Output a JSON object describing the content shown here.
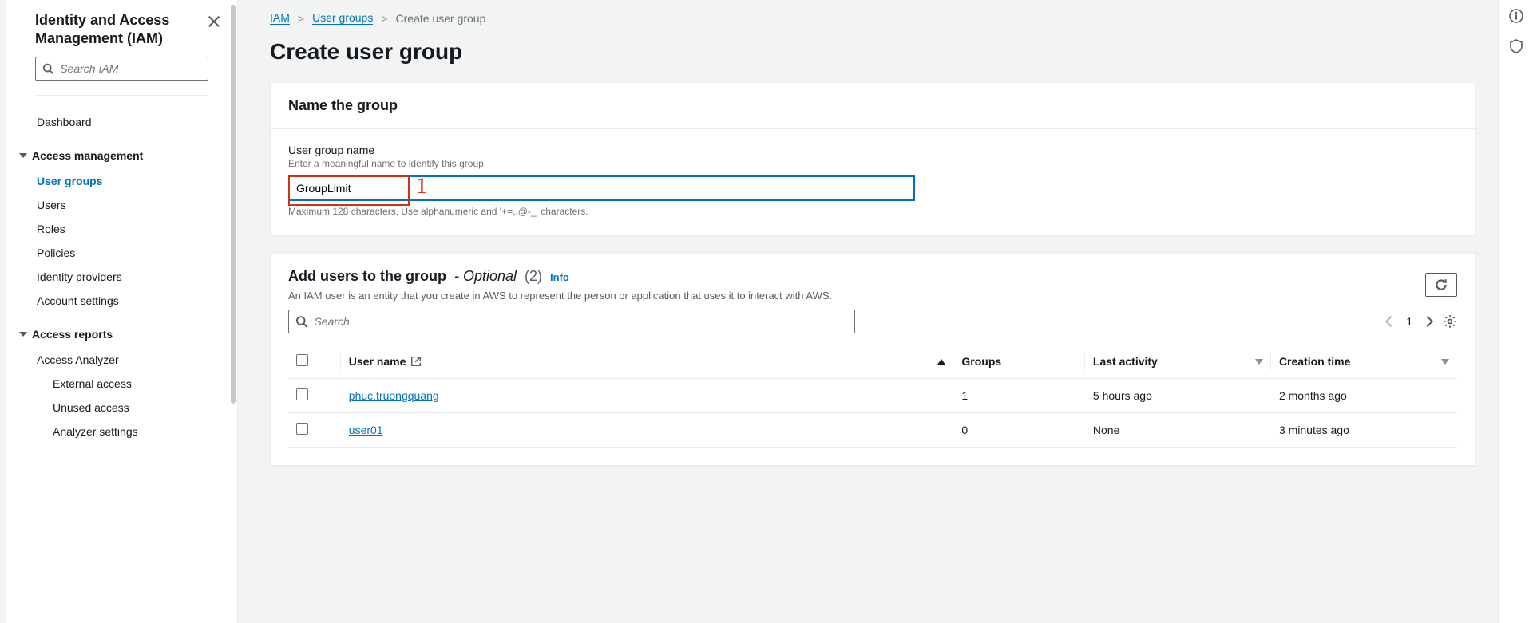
{
  "sidebar": {
    "title": "Identity and Access Management (IAM)",
    "search_placeholder": "Search IAM",
    "dashboard": "Dashboard",
    "section_access_mgmt": "Access management",
    "items_access_mgmt": [
      "User groups",
      "Users",
      "Roles",
      "Policies",
      "Identity providers",
      "Account settings"
    ],
    "section_access_reports": "Access reports",
    "items_access_reports": [
      "Access Analyzer",
      "External access",
      "Unused access",
      "Analyzer settings"
    ]
  },
  "breadcrumb": {
    "iam": "IAM",
    "groups": "User groups",
    "current": "Create user group"
  },
  "page": {
    "title": "Create user group"
  },
  "name_panel": {
    "heading": "Name the group",
    "label": "User group name",
    "description": "Enter a meaningful name to identify this group.",
    "value": "GroupLimit",
    "hint": "Maximum 128 characters. Use alphanumeric and '+=,.@-_' characters.",
    "marker": "1"
  },
  "add_users_panel": {
    "heading": "Add users to the group",
    "optional": "- Optional",
    "count": "(2)",
    "info": "Info",
    "description": "An IAM user is an entity that you create in AWS to represent the person or application that uses it to interact with AWS.",
    "search_placeholder": "Search",
    "page_num": "1",
    "columns": {
      "username": "User name",
      "groups": "Groups",
      "last_activity": "Last activity",
      "creation_time": "Creation time"
    },
    "rows": [
      {
        "username": "phuc.truongquang",
        "groups": "1",
        "last_activity": "5 hours ago",
        "creation_time": "2 months ago"
      },
      {
        "username": "user01",
        "groups": "0",
        "last_activity": "None",
        "creation_time": "3 minutes ago"
      }
    ]
  }
}
